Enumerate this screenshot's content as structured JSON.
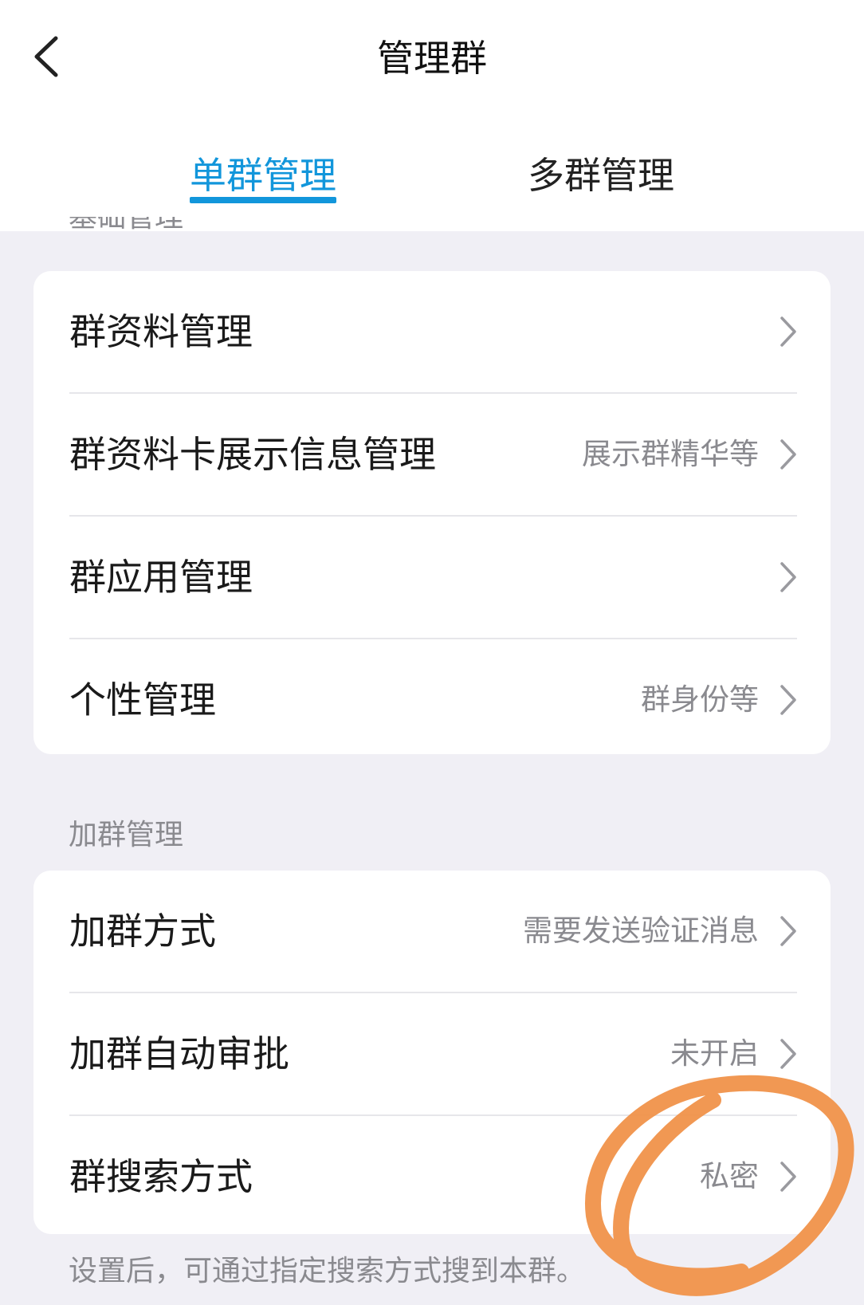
{
  "header": {
    "title": "管理群"
  },
  "tabs": [
    {
      "label": "单群管理",
      "active": true
    },
    {
      "label": "多群管理",
      "active": false
    }
  ],
  "sections": {
    "basic": {
      "label": "基础管理",
      "rows": [
        {
          "title": "群资料管理",
          "value": ""
        },
        {
          "title": "群资料卡展示信息管理",
          "value": "展示群精华等"
        },
        {
          "title": "群应用管理",
          "value": ""
        },
        {
          "title": "个性管理",
          "value": "群身份等"
        }
      ]
    },
    "join": {
      "label": "加群管理",
      "rows": [
        {
          "title": "加群方式",
          "value": "需要发送验证消息"
        },
        {
          "title": "加群自动审批",
          "value": "未开启"
        },
        {
          "title": "群搜索方式",
          "value": "私密"
        }
      ],
      "note": "设置后，可通过指定搜索方式搜到本群。"
    }
  },
  "colors": {
    "accent": "#1296db",
    "background": "#f0eff5",
    "annotation": "#f0924a"
  },
  "icons": {
    "back": "chevron-left-icon",
    "row_arrow": "chevron-right-icon"
  }
}
